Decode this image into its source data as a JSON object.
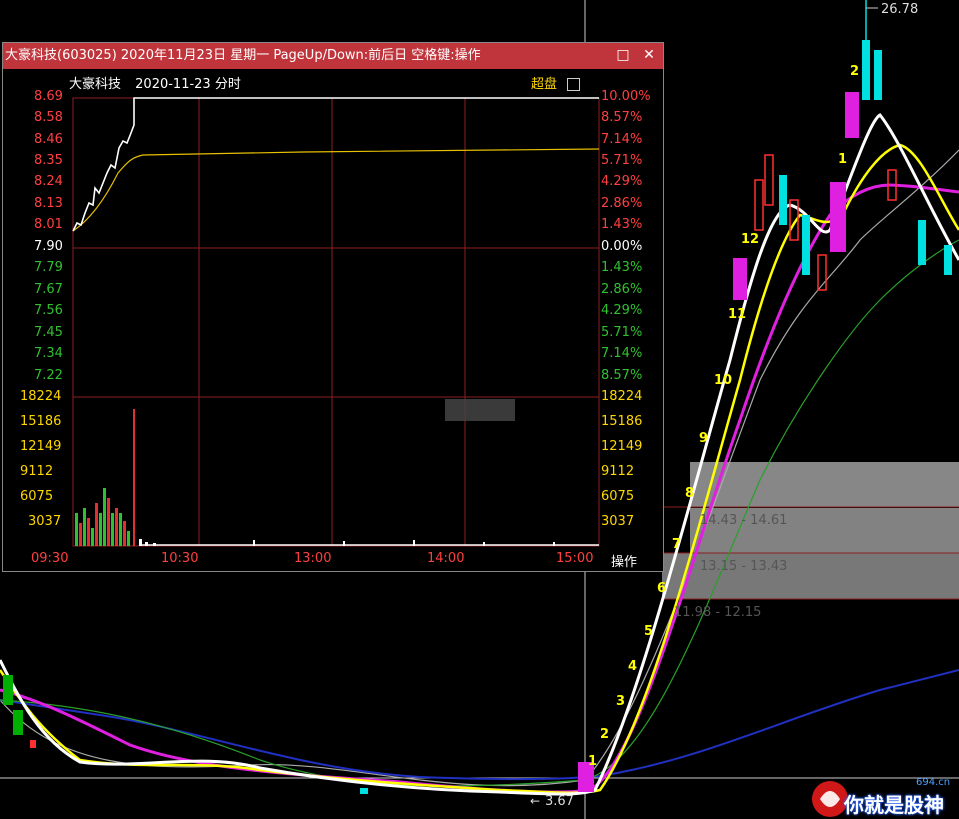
{
  "window": {
    "title": "大豪科技(603025) 2020年11月23日 星期一 PageUp/Down:前后日 空格键:操作",
    "restore_icon": "□",
    "close_icon": "✕"
  },
  "intraday": {
    "stock_name": "大豪科技",
    "date_label": "2020-11-23 分时",
    "super_label": "超盘",
    "price_ticks": [
      "8.69",
      "8.58",
      "8.46",
      "8.35",
      "8.24",
      "8.13",
      "8.01",
      "7.90",
      "7.79",
      "7.67",
      "7.56",
      "7.45",
      "7.34",
      "7.22"
    ],
    "pct_ticks": [
      "10.00%",
      "8.57%",
      "7.14%",
      "5.71%",
      "4.29%",
      "2.86%",
      "1.43%",
      "0.00%",
      "1.43%",
      "2.86%",
      "4.29%",
      "5.71%",
      "7.14%",
      "8.57%"
    ],
    "volume_ticks_left": [
      "18224",
      "15186",
      "12149",
      "9112",
      "6075",
      "3037"
    ],
    "volume_ticks_right": [
      "18224",
      "15186",
      "12149",
      "9112",
      "6075",
      "3037"
    ],
    "time_ticks": [
      "09:30",
      "10:30",
      "13:00",
      "14:00",
      "15:00"
    ],
    "operate_label": "操作"
  },
  "kline": {
    "high_label": "26.78",
    "low_label": "3.67",
    "wave_labels": [
      "1",
      "2",
      "3",
      "4",
      "5",
      "6",
      "7",
      "8",
      "9",
      "10",
      "11",
      "12",
      "1",
      "2"
    ],
    "box1": "14.43 - 14.61",
    "box2": "13.15 - 13.43",
    "box3": "11.98 - 12.15",
    "colors": {
      "white_ma": "#ffffff",
      "yellow_ma": "#ffff00",
      "magenta_ma": "#e020e0",
      "green_ma": "#2aa02a",
      "blue_ma": "#2030c0",
      "gray_ma": "#a0a0a0"
    }
  },
  "watermark": {
    "site": "694.cn",
    "text": "你就是股神"
  }
}
